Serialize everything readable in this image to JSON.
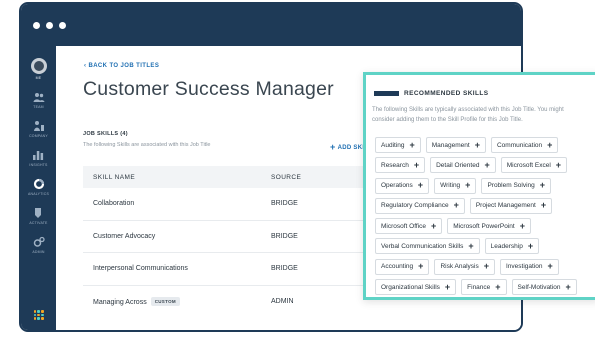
{
  "sidebar": {
    "avatar_label": "ME",
    "items": [
      {
        "label": "TEAM",
        "icon": "team-icon"
      },
      {
        "label": "COMPANY",
        "icon": "company-icon"
      },
      {
        "label": "INSIGHTS",
        "icon": "insights-icon"
      },
      {
        "label": "ANALYTICS",
        "icon": "analytics-icon"
      },
      {
        "label": "ACTIVATE",
        "icon": "activate-icon"
      },
      {
        "label": "ADMIN",
        "icon": "admin-icon"
      }
    ]
  },
  "main": {
    "back_link": "BACK TO JOB TITLES",
    "title": "Customer Success Manager",
    "section_title": "JOB SKILLS (4)",
    "section_sub": "The following Skills are associated with this Job Title",
    "add_skill": "ADD SKILL",
    "table": {
      "headers": [
        "SKILL NAME",
        "SOURCE"
      ],
      "rows": [
        {
          "name": "Collaboration",
          "source": "BRIDGE",
          "badge": ""
        },
        {
          "name": "Customer Advocacy",
          "source": "BRIDGE",
          "badge": ""
        },
        {
          "name": "Interpersonal Communications",
          "source": "BRIDGE",
          "badge": ""
        },
        {
          "name": "Managing Across",
          "source": "ADMIN",
          "badge": "CUSTOM"
        }
      ]
    }
  },
  "recommended": {
    "title": "RECOMMENDED SKILLS",
    "desc_line1": "The following Skills are typically associated with this Job Title. You might",
    "desc_line2": "consider adding them to the Skill Profile for this Job Title.",
    "rows": [
      [
        "Auditing",
        "Management",
        "Communication"
      ],
      [
        "Research",
        "Detail Oriented",
        "Microsoft Excel"
      ],
      [
        "Operations",
        "Writing",
        "Problem Solving"
      ],
      [
        "Regulatory Compliance",
        "Project Management"
      ],
      [
        "Microsoft Office",
        "Microsoft PowerPoint"
      ],
      [
        "Verbal Communication Skills",
        "Leadership"
      ],
      [
        "Accounting",
        "Risk Analysis",
        "Investigation"
      ],
      [
        "Organizational Skills",
        "Finance",
        "Self-Motivation"
      ]
    ],
    "add_symbol": "+"
  },
  "colors": {
    "brand_navy": "#1e3a57",
    "panel_border": "#5fd3c6",
    "link_blue": "#1f6fb2"
  }
}
